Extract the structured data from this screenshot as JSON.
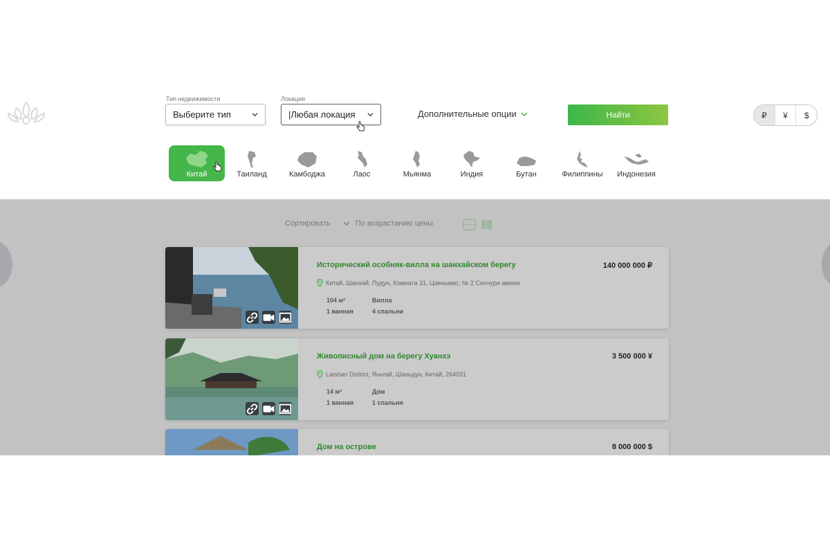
{
  "colors": {
    "accent": "#45b649",
    "title_green": "#2f8a2f",
    "results_bg": "#c2c2c2"
  },
  "logo": {
    "icon": "lotus-logo-icon"
  },
  "filters": {
    "type_label": "Тип недвижимости",
    "type_value": "Выберите тип",
    "location_label": "Локация",
    "location_value": "|Любая локация",
    "more_options": "Дополнительные опции",
    "find_button": "Найти"
  },
  "currencies": [
    "₽",
    "¥",
    "$"
  ],
  "currency_selected": "₽",
  "countries": [
    {
      "label": "Китай",
      "selected": true
    },
    {
      "label": "Таиланд",
      "selected": false
    },
    {
      "label": "Камбоджа",
      "selected": false
    },
    {
      "label": "Лаос",
      "selected": false
    },
    {
      "label": "Мьянма",
      "selected": false
    },
    {
      "label": "Индия",
      "selected": false
    },
    {
      "label": "Бутан",
      "selected": false
    },
    {
      "label": "Филиппины",
      "selected": false
    },
    {
      "label": "Индонезия",
      "selected": false
    }
  ],
  "sort": {
    "label": "Сортировать",
    "value": "По возрастанию цены"
  },
  "listings": [
    {
      "title": "Исторический особняк-вилла на шанхайском берегу",
      "price": "140 000 000 ₽",
      "address": "Китай, Шанхай, Пудун, Комната 31, Цзиньмао, № 2 Сенчури авеню",
      "area": "104 м²",
      "baths": "1 ванная",
      "type": "Вилла",
      "bedrooms": "4 спальни"
    },
    {
      "title": "Живописный дом на берегу Хуанхэ",
      "price": "3 500 000 ¥",
      "address": "Laishan District, Яньтай, Шаньдун, Китай, 264031",
      "area": "14 м²",
      "baths": "1 ванная",
      "type": "Дом",
      "bedrooms": "1 спальня"
    },
    {
      "title": "Дом на острове",
      "price": "8 000 000 $"
    }
  ]
}
